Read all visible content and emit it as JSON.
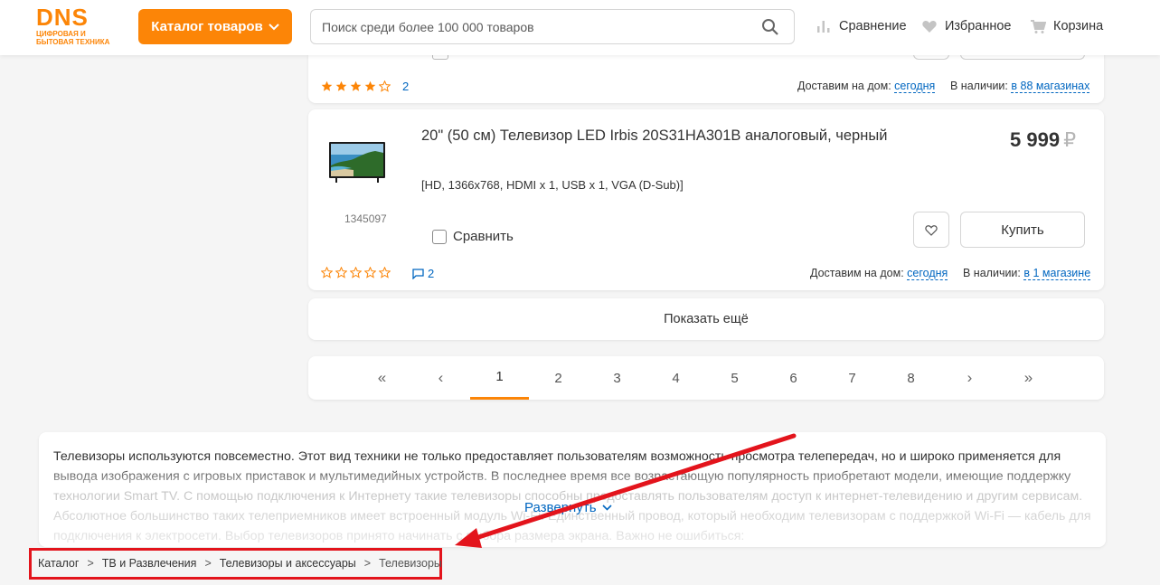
{
  "header": {
    "logo_main": "DNS",
    "logo_sub": "Цифровая и бытовая техника",
    "catalog_button": "Каталог товаров",
    "search_placeholder": "Поиск среди более 100 000 товаров",
    "compare_link": "Сравнение",
    "favorites_link": "Избранное",
    "cart_link": "Корзина"
  },
  "prev_product": {
    "rating_stars": 4,
    "rating_max": 5,
    "rating_count": "2",
    "delivery_label": "Доставим на дом:",
    "delivery_value": "сегодня",
    "availability_label": "В наличии:",
    "availability_value": "в 88 магазинах"
  },
  "product": {
    "title": "20\" (50 см) Телевизор LED Irbis 20S31HA301B аналоговый, черный",
    "specs": "[HD, 1366x768, HDMI x 1, USB x 1, VGA (D-Sub)]",
    "sku": "1345097",
    "price": "5 999",
    "currency": "₽",
    "compare_label": "Сравнить",
    "buy_label": "Купить",
    "rating_stars": 0,
    "rating_max": 5,
    "reviews_count": "2",
    "delivery_label": "Доставим на дом:",
    "delivery_value": "сегодня",
    "availability_label": "В наличии:",
    "availability_value": "в 1 магазине"
  },
  "show_more": "Показать ещё",
  "pagination": {
    "first": "«",
    "prev": "‹",
    "pages": [
      "1",
      "2",
      "3",
      "4",
      "5",
      "6",
      "7",
      "8"
    ],
    "current": "1",
    "next": "›",
    "last": "»"
  },
  "seo": {
    "text": "Телевизоры используются повсеместно. Этот вид техники не только предоставляет пользователям возможность просмотра телепередач, но и широко применяется для вывода изображения с игровых приставок и мультимедийных устройств. В последнее время все возрастающую популярность приобретают модели, имеющие поддержку технологии Smart TV. С помощью подключения к Интернету такие телевизоры способны предоставлять пользователям доступ к интернет-телевидению и другим сервисам. Абсолютное большинство таких телеприемников имеет встроенный модуль Wi-Fi. Единственный провод, который необходим телевизорам с поддержкой Wi-Fi — кабель для подключения к электросети. Выбор телевизоров принято начинать с выбора размера экрана. Важно не ошибиться:",
    "expand_label": "Развернуть"
  },
  "breadcrumb": [
    "Каталог",
    "ТВ и Развлечения",
    "Телевизоры и аксессуары",
    "Телевизоры"
  ],
  "colors": {
    "accent": "#fc8507",
    "link": "#0066c0",
    "annotation_red": "#e3141c"
  }
}
